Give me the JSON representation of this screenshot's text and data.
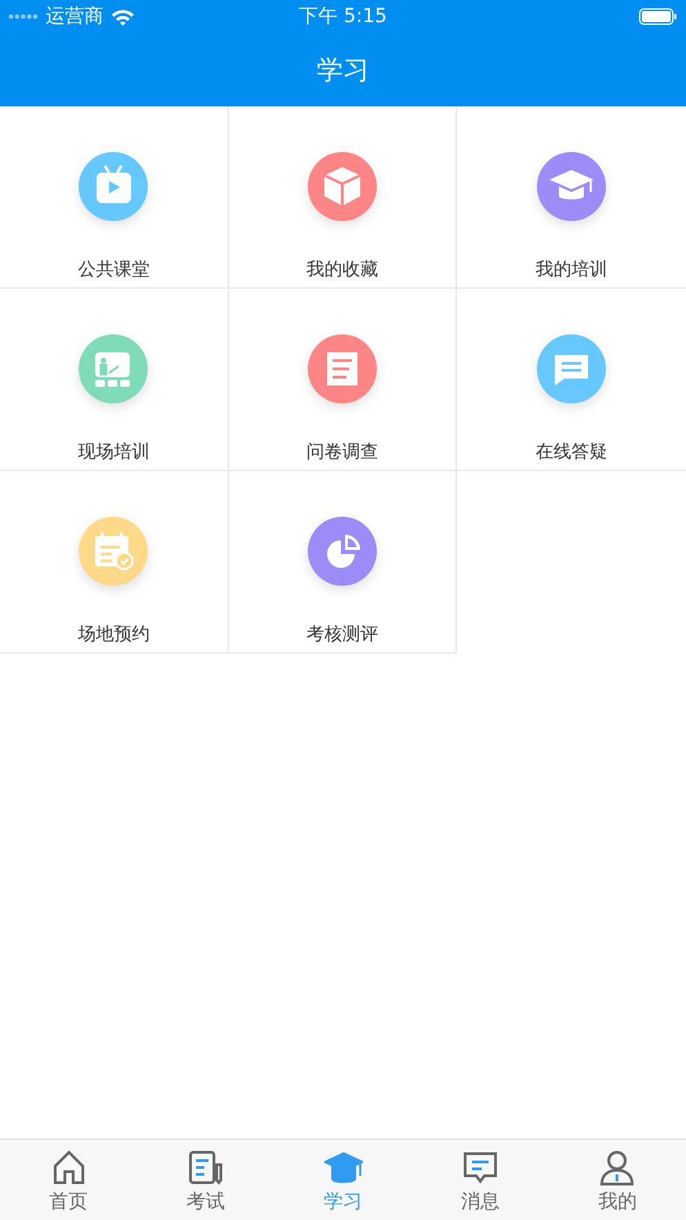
{
  "status_bar": {
    "carrier": "运营商",
    "time": "下午 5:15"
  },
  "nav": {
    "title": "学习"
  },
  "grid": [
    {
      "label": "公共课堂",
      "kind": "tv",
      "color": "#66c8fe"
    },
    {
      "label": "我的收藏",
      "kind": "box",
      "color": "#fd8585"
    },
    {
      "label": "我的培训",
      "kind": "cap",
      "color": "#9c8cf8"
    },
    {
      "label": "现场培训",
      "kind": "board",
      "color": "#7fdbb8"
    },
    {
      "label": "问卷调查",
      "kind": "doc",
      "color": "#fd8585"
    },
    {
      "label": "在线答疑",
      "kind": "chat",
      "color": "#66c8fe"
    },
    {
      "label": "场地预约",
      "kind": "calendar",
      "color": "#fed98a"
    },
    {
      "label": "考核测评",
      "kind": "pie",
      "color": "#9c8cf8"
    }
  ],
  "tabs": [
    {
      "label": "首页",
      "kind": "home",
      "selected": false
    },
    {
      "label": "考试",
      "kind": "exam",
      "selected": false
    },
    {
      "label": "学习",
      "kind": "cap",
      "selected": true
    },
    {
      "label": "消息",
      "kind": "message",
      "selected": false
    },
    {
      "label": "我的",
      "kind": "person",
      "selected": false
    }
  ]
}
